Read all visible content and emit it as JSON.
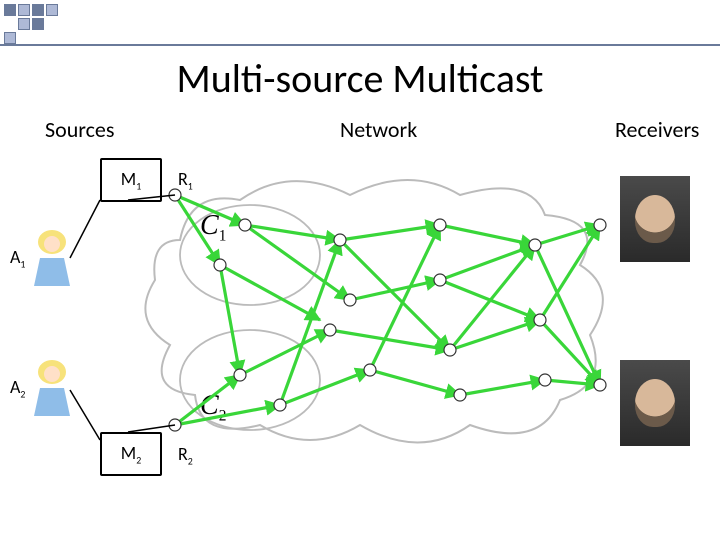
{
  "title": "Multi-source Multicast",
  "columns": {
    "sources": "Sources",
    "network": "Network",
    "receivers": "Receivers"
  },
  "sources": {
    "a1": {
      "label": "A1",
      "message_box": "M1",
      "ingress_port": "R1",
      "capacity_label": "C1"
    },
    "a2": {
      "label": "A2",
      "message_box": "M2",
      "ingress_port": "R2",
      "capacity_label": "C2"
    }
  },
  "receivers": {
    "b1": {
      "label": ""
    },
    "b2": {
      "label": ""
    }
  },
  "network": {
    "description": "cloud graph with internal routers; green arrows indicate directed multicast flows from two sources across the network to two receivers"
  }
}
